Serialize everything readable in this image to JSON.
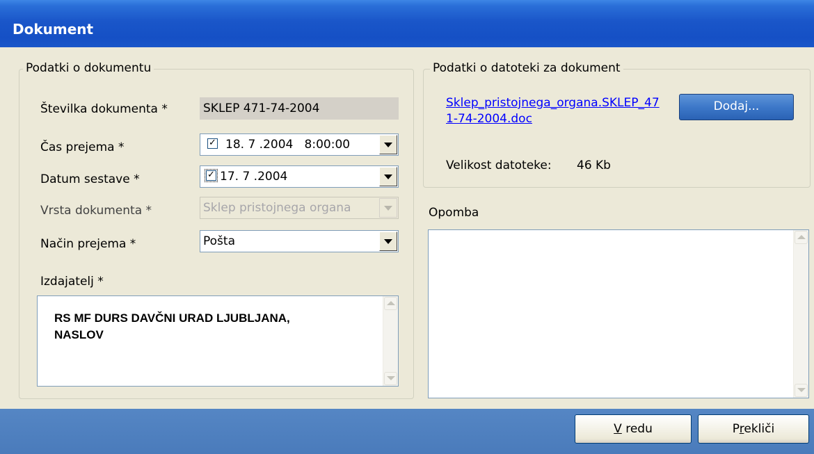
{
  "window": {
    "title": "Dokument"
  },
  "document_group": {
    "legend": "Podatki o dokumentu",
    "stevilka_label": "Številka dokumenta *",
    "stevilka_value": "SKLEP 471-74-2004",
    "cas_label": "Čas prejema *",
    "cas_value": "18. 7 .2004   8:00:00",
    "datum_label": "Datum sestave *",
    "datum_value": "17. 7 .2004",
    "vrsta_label": "Vrsta dokumenta *",
    "vrsta_value": "Sklep pristojnega organa",
    "nacin_label": "Način prejema *",
    "nacin_value": "Pošta",
    "izdajatelj_label": "Izdajatelj *",
    "izdajatelj_value": "RS MF DURS DAVČNI URAD LJUBLJANA, NASLOV"
  },
  "file_group": {
    "legend": "Podatki o datoteki za dokument",
    "file_link": "Sklep_pristojnega_organa.SKLEP_471-74-2004.doc",
    "add_button": "Dodaj...",
    "size_label": "Velikost datoteke:",
    "size_value": "46 Kb"
  },
  "opomba": {
    "label": "Opomba",
    "value": ""
  },
  "footer": {
    "ok_mnemonic": "V",
    "ok_rest": " redu",
    "cancel_pre": "P",
    "cancel_mnemonic": "r",
    "cancel_rest": "ekliči"
  },
  "icons": [
    "checkbox-checked-icon",
    "dropdown-arrow-icon",
    "scroll-up-arrow-icon",
    "scroll-down-arrow-icon"
  ],
  "colors": {
    "titlebar": "#1550c5",
    "dialog_bg": "#ece9d8",
    "footer": "#4a7bbb",
    "link": "#0000ff"
  }
}
